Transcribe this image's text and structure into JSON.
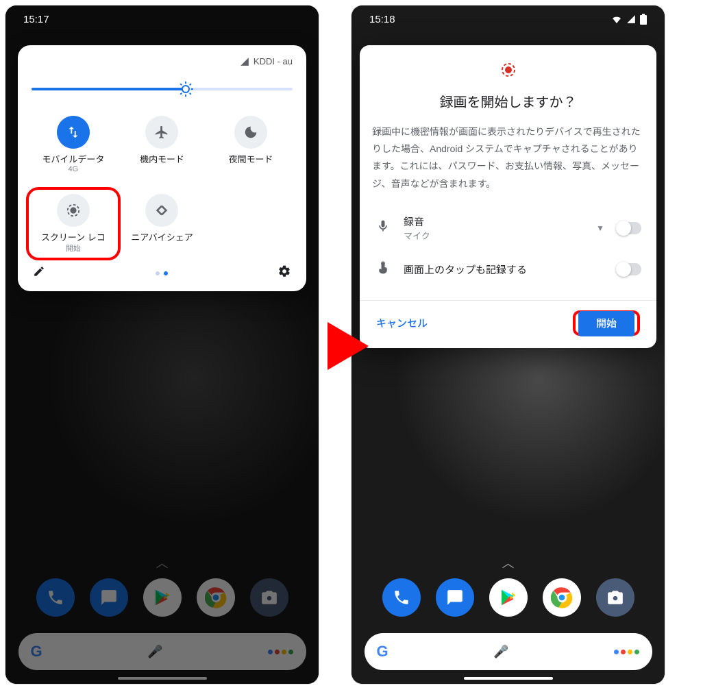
{
  "left": {
    "status_time": "15:17",
    "carrier": "KDDI - au",
    "slider_value_pct": 58,
    "tiles": [
      {
        "name": "mobile-data",
        "label": "モバイルデータ",
        "sub": "4G",
        "active": true,
        "icon": "swap-vertical-icon"
      },
      {
        "name": "airplane-mode",
        "label": "機内モード",
        "sub": "",
        "active": false,
        "icon": "airplane-icon"
      },
      {
        "name": "night-mode",
        "label": "夜間モード",
        "sub": "",
        "active": false,
        "icon": "moon-icon"
      },
      {
        "name": "screen-record",
        "label": "スクリーン レコ",
        "sub": "開始",
        "active": false,
        "icon": "record-target-icon",
        "highlighted": true
      },
      {
        "name": "nearby-share",
        "label": "ニアバイシェア",
        "sub": "",
        "active": false,
        "icon": "nearby-icon"
      }
    ],
    "page_dot_active": 2,
    "page_dot_count": 2
  },
  "right": {
    "status_time": "15:18",
    "dialog": {
      "title": "録画を開始しますか？",
      "body": "録画中に機密情報が画面に表示されたりデバイスで再生されたりした場合、Android システムでキャプチャされることがあります。これには、パスワード、お支払い情報、写真、メッセージ、音声などが含まれます。",
      "options": [
        {
          "name": "record-audio",
          "label": "録音",
          "sub": "マイク",
          "icon": "mic-icon",
          "caret": true,
          "toggle": false
        },
        {
          "name": "record-taps",
          "label": "画面上のタップも記録する",
          "sub": "",
          "icon": "touch-icon",
          "caret": false,
          "toggle": false
        }
      ],
      "cancel_label": "キャンセル",
      "start_label": "開始"
    }
  },
  "home": {
    "dock": [
      {
        "name": "phone-app",
        "bg": "#1a73e8",
        "glyph": "phone"
      },
      {
        "name": "messages-app",
        "bg": "#1a73e8",
        "glyph": "message"
      },
      {
        "name": "play-store-app",
        "bg": "#ffffff",
        "glyph": "play"
      },
      {
        "name": "chrome-app",
        "bg": "#ffffff",
        "glyph": "chrome"
      },
      {
        "name": "camera-app",
        "bg": "#4a5b78",
        "glyph": "camera"
      }
    ],
    "search_brand": "Google"
  }
}
